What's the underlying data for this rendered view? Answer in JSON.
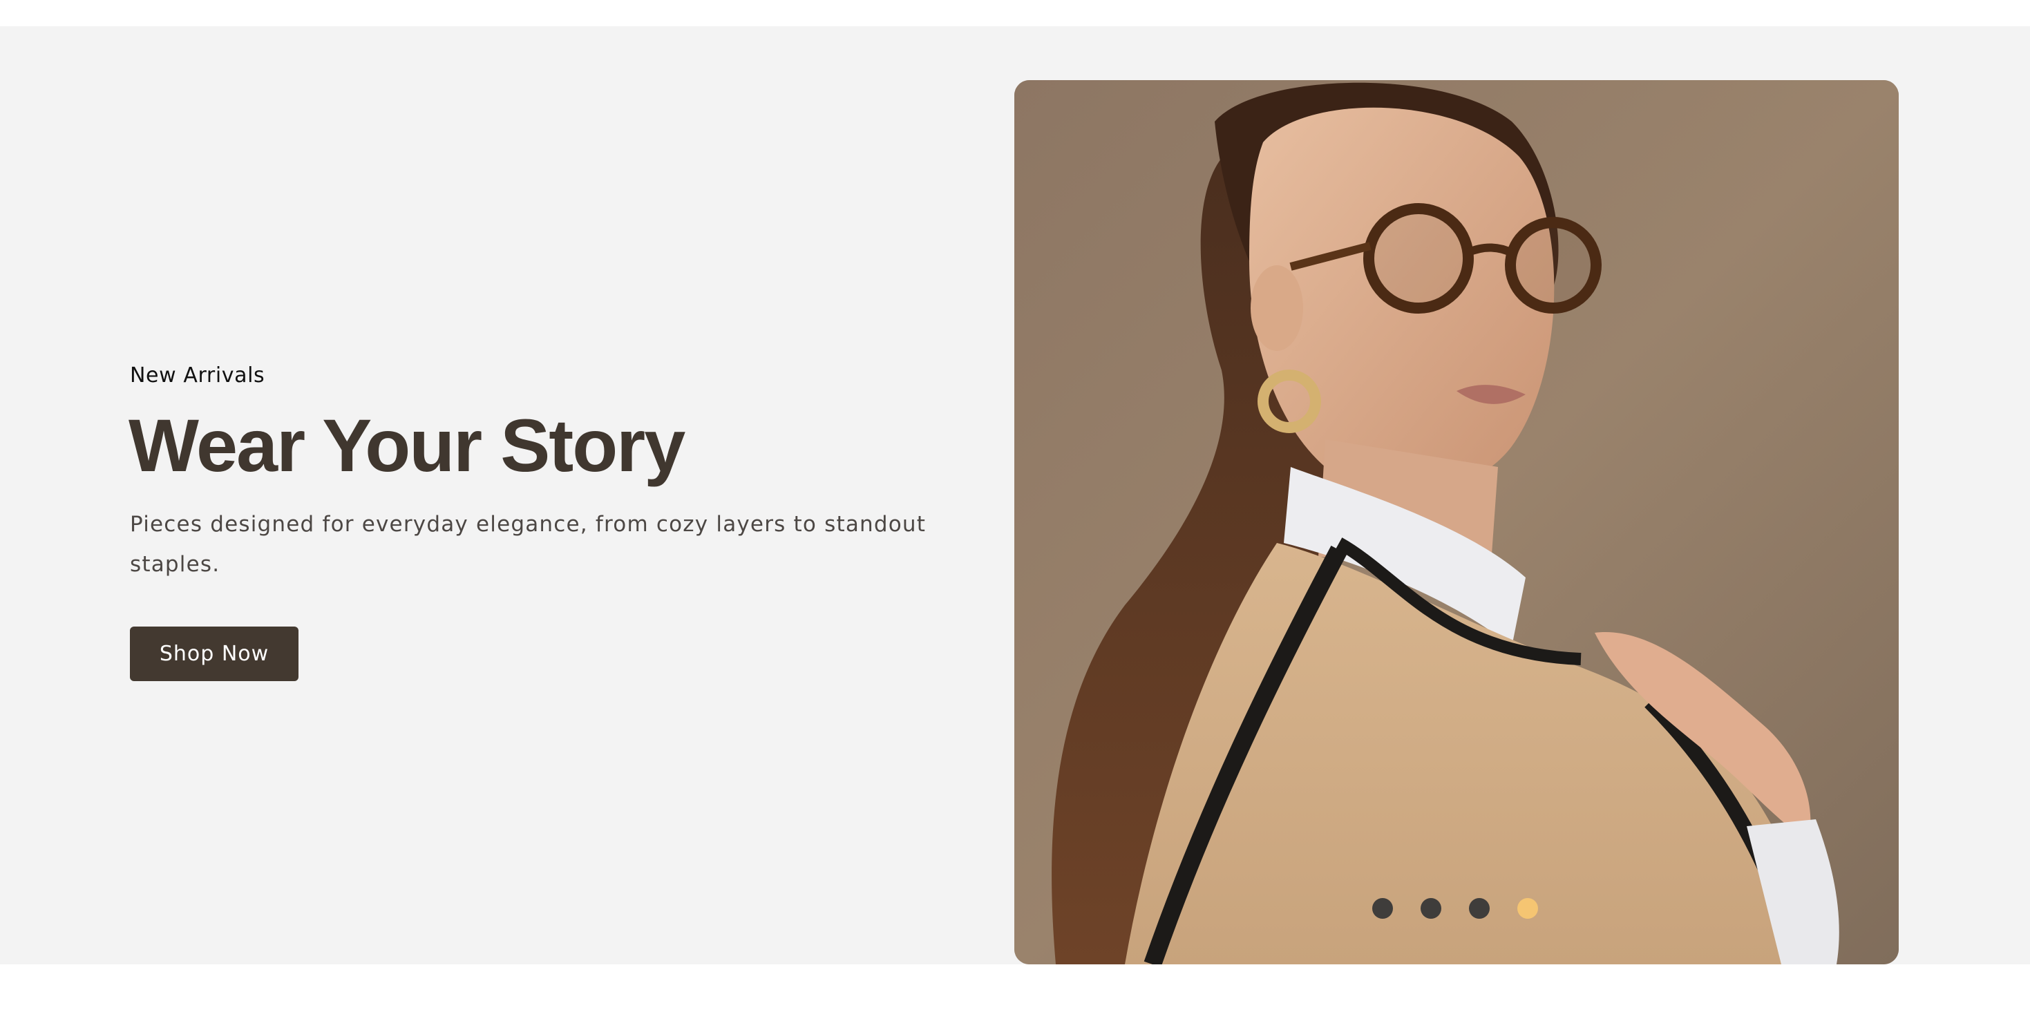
{
  "hero": {
    "eyebrow": "New Arrivals",
    "title": "Wear Your Story",
    "description": "Pieces designed for everyday elegance, from cozy layers to standout staples.",
    "cta_label": "Shop Now",
    "image_alt": "Woman wearing round tortoiseshell glasses, gold hoop earring and a beige poncho over a white turtleneck"
  },
  "carousel": {
    "slide_count": 4,
    "active_index": 3
  },
  "colors": {
    "hero_background": "#f3f3f3",
    "heading": "#40372f",
    "button_background": "#433930",
    "dot_inactive": "#3f3d3b",
    "dot_active": "#f5c572"
  }
}
